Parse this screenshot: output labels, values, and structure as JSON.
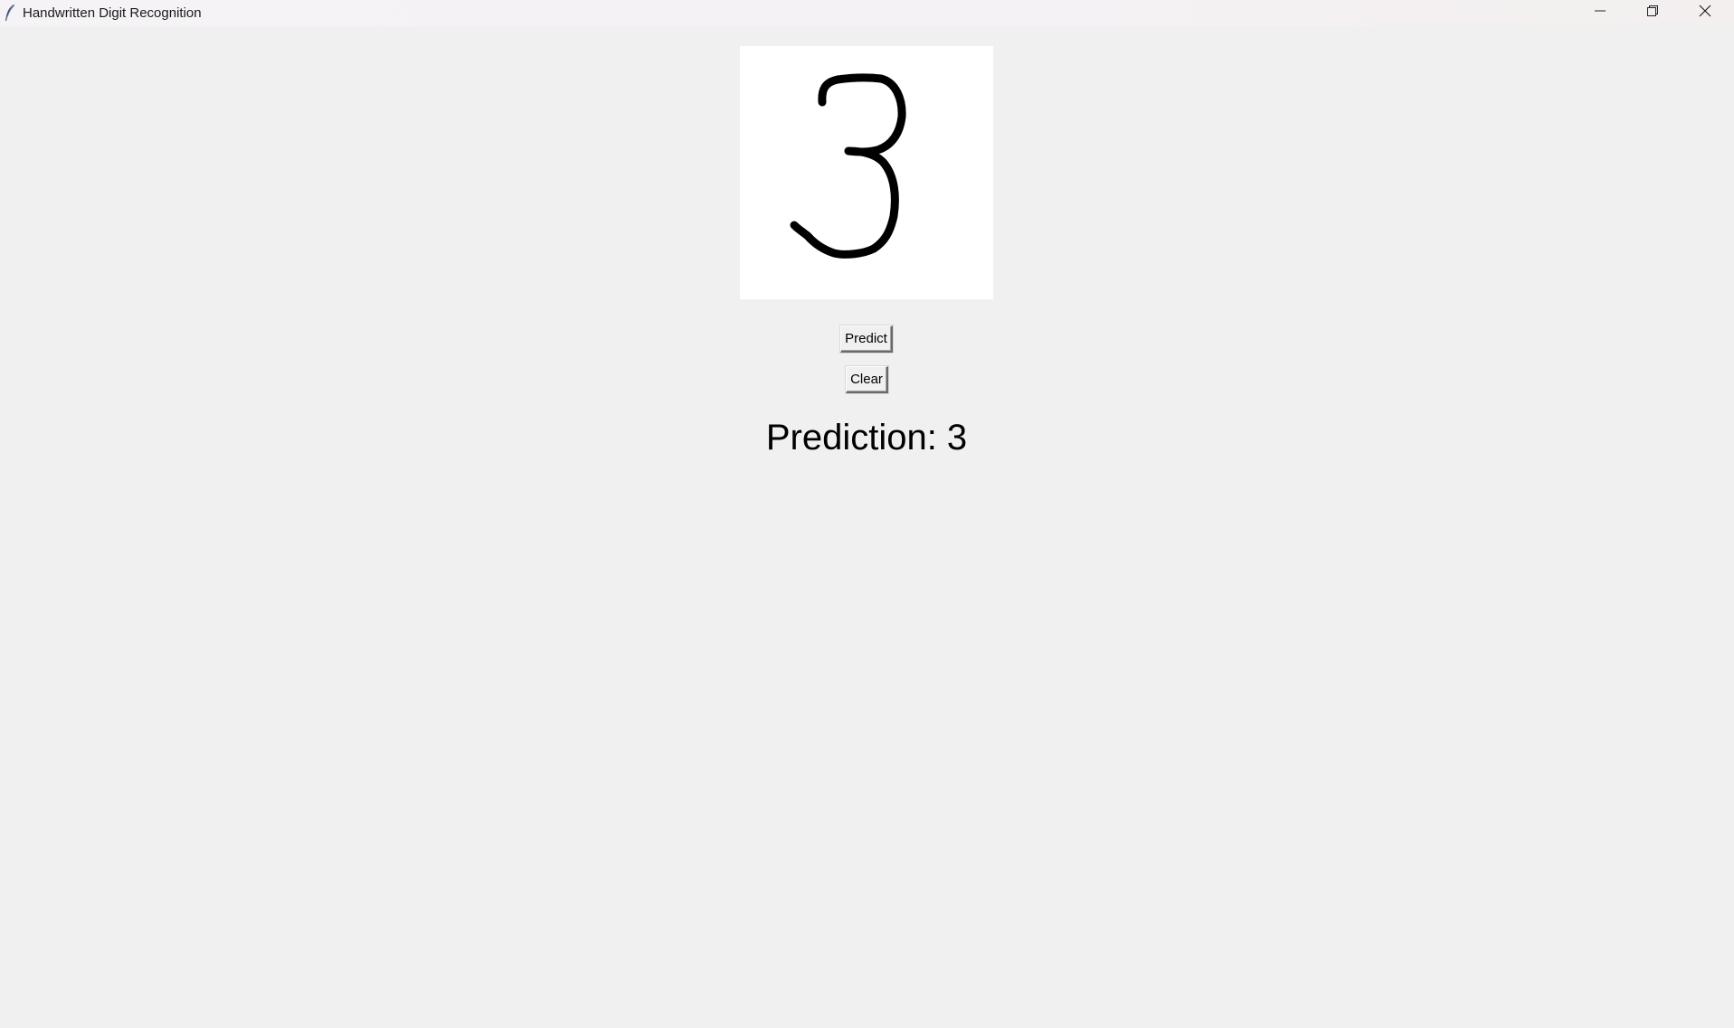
{
  "window": {
    "title": "Handwritten Digit Recognition",
    "app_icon": "feather-icon",
    "controls": {
      "minimize_icon": "minimize-icon",
      "maximize_icon": "restore-icon",
      "close_icon": "close-icon"
    }
  },
  "canvas": {
    "background_color": "#ffffff",
    "stroke_color": "#000000",
    "drawn_content": "handwritten-digit-stroke"
  },
  "buttons": {
    "predict_label": "Predict",
    "clear_label": "Clear"
  },
  "result": {
    "prediction_text": "Prediction: 3"
  },
  "colors": {
    "window_bg": "#f0f0f0",
    "titlebar_bg": "#f4f2f4",
    "text": "#000000"
  }
}
